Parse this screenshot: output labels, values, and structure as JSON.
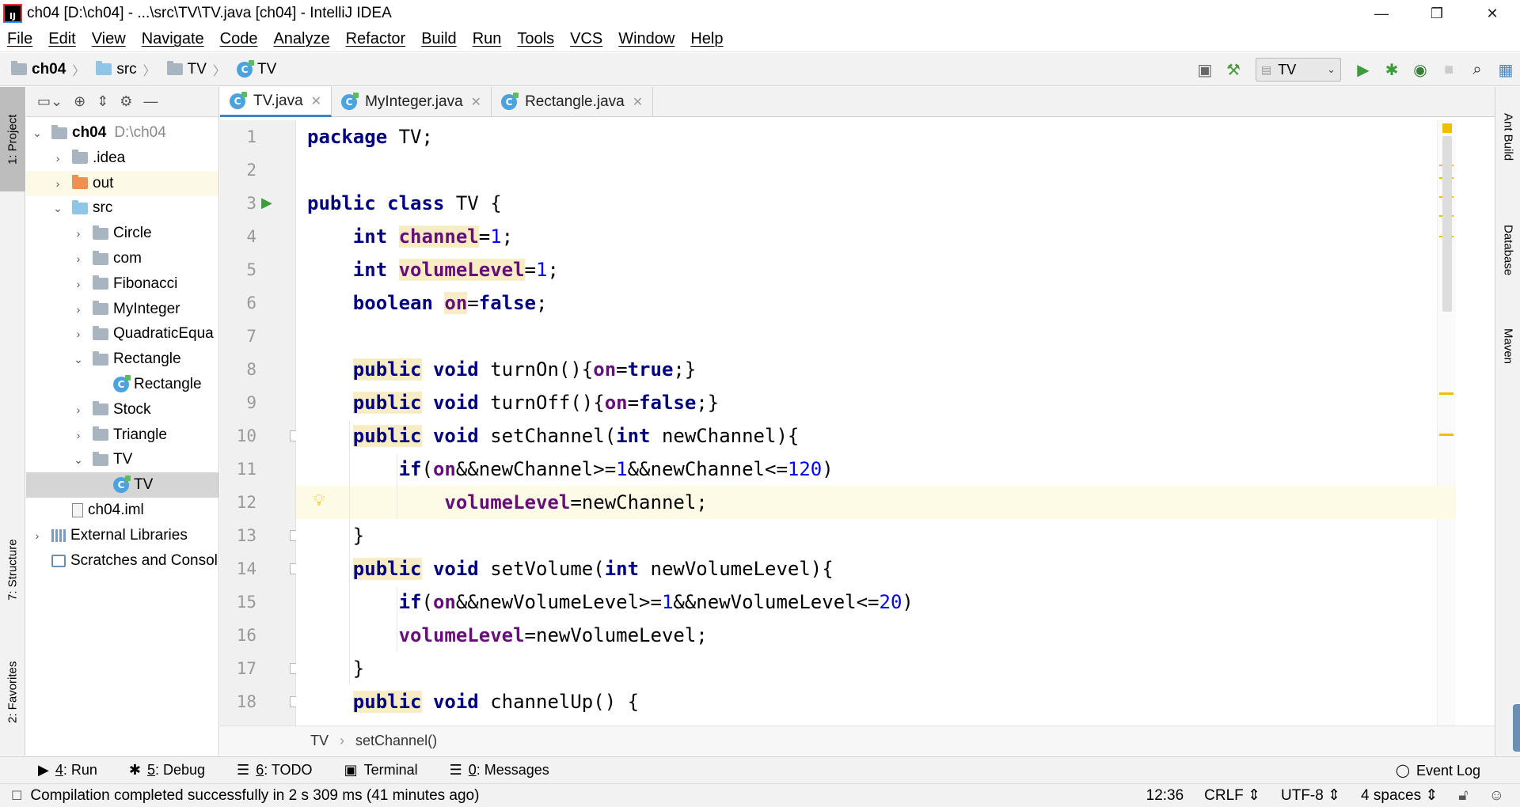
{
  "window": {
    "title": "ch04 [D:\\ch04] - ...\\src\\TV\\TV.java [ch04] - IntelliJ IDEA",
    "app_icon_text": "IJ",
    "controls": [
      "—",
      "❐",
      "✕"
    ]
  },
  "menu": [
    "File",
    "Edit",
    "View",
    "Navigate",
    "Code",
    "Analyze",
    "Refactor",
    "Build",
    "Run",
    "Tools",
    "VCS",
    "Window",
    "Help"
  ],
  "navbar": {
    "breadcrumbs": [
      "ch04",
      "src",
      "TV",
      "TV"
    ],
    "run_config": "TV"
  },
  "left_tool_tabs": [
    "1: Project",
    "7: Structure",
    "2: Favorites"
  ],
  "right_tool_tabs": [
    "Ant Build",
    "Database",
    "Maven"
  ],
  "project_tree": [
    {
      "label": "ch04",
      "path": "D:\\ch04",
      "depth": 0,
      "arrow": "⌄",
      "icon": "folder-grey",
      "bold": true
    },
    {
      "label": ".idea",
      "depth": 1,
      "arrow": "›",
      "icon": "folder-grey"
    },
    {
      "label": "out",
      "depth": 1,
      "arrow": "›",
      "icon": "folder-orange"
    },
    {
      "label": "src",
      "depth": 1,
      "arrow": "⌄",
      "icon": "folder-blue"
    },
    {
      "label": "Circle",
      "depth": 2,
      "arrow": "›",
      "icon": "folder-grey"
    },
    {
      "label": "com",
      "depth": 2,
      "arrow": "›",
      "icon": "folder-grey"
    },
    {
      "label": "Fibonacci",
      "depth": 2,
      "arrow": "›",
      "icon": "folder-grey"
    },
    {
      "label": "MyInteger",
      "depth": 2,
      "arrow": "›",
      "icon": "folder-grey"
    },
    {
      "label": "QuadraticEqua",
      "depth": 2,
      "arrow": "›",
      "icon": "folder-grey"
    },
    {
      "label": "Rectangle",
      "depth": 2,
      "arrow": "⌄",
      "icon": "folder-grey"
    },
    {
      "label": "Rectangle",
      "depth": 3,
      "arrow": "",
      "icon": "class"
    },
    {
      "label": "Stock",
      "depth": 2,
      "arrow": "›",
      "icon": "folder-grey"
    },
    {
      "label": "Triangle",
      "depth": 2,
      "arrow": "›",
      "icon": "folder-grey"
    },
    {
      "label": "TV",
      "depth": 2,
      "arrow": "⌄",
      "icon": "folder-grey"
    },
    {
      "label": "TV",
      "depth": 3,
      "arrow": "",
      "icon": "class",
      "selected": true
    },
    {
      "label": "ch04.iml",
      "depth": 1,
      "arrow": "",
      "icon": "file"
    },
    {
      "label": "External Libraries",
      "depth": 0,
      "arrow": "›",
      "icon": "library"
    },
    {
      "label": "Scratches and Consol",
      "depth": 0,
      "arrow": "",
      "icon": "scratch"
    }
  ],
  "editor_tabs": [
    {
      "label": "TV.java",
      "active": true
    },
    {
      "label": "MyInteger.java",
      "active": false
    },
    {
      "label": "Rectangle.java",
      "active": false
    }
  ],
  "code_lines": [
    [
      [
        "kw",
        "package"
      ],
      [
        "t",
        " TV;"
      ]
    ],
    [],
    [
      [
        "kw",
        "public class"
      ],
      [
        "t",
        " TV {"
      ]
    ],
    [
      [
        "t",
        "    "
      ],
      [
        "kw",
        "int "
      ],
      [
        "fldm",
        "channel"
      ],
      [
        "t",
        "="
      ],
      [
        "num",
        "1"
      ],
      [
        "t",
        ";"
      ]
    ],
    [
      [
        "t",
        "    "
      ],
      [
        "kw",
        "int "
      ],
      [
        "fldm",
        "volumeLevel"
      ],
      [
        "t",
        "="
      ],
      [
        "num",
        "1"
      ],
      [
        "t",
        ";"
      ]
    ],
    [
      [
        "t",
        "    "
      ],
      [
        "kw",
        "boolean "
      ],
      [
        "fldm",
        "on"
      ],
      [
        "t",
        "="
      ],
      [
        "kw",
        "false"
      ],
      [
        "t",
        ";"
      ]
    ],
    [],
    [
      [
        "t",
        "    "
      ],
      [
        "kwm",
        "public"
      ],
      [
        "kw",
        " void"
      ],
      [
        "t",
        " turnOn(){"
      ],
      [
        "fld",
        "on"
      ],
      [
        "t",
        "="
      ],
      [
        "kw",
        "true"
      ],
      [
        "t",
        ";}"
      ]
    ],
    [
      [
        "t",
        "    "
      ],
      [
        "kwm",
        "public"
      ],
      [
        "kw",
        " void"
      ],
      [
        "t",
        " turnOff(){"
      ],
      [
        "fld",
        "on"
      ],
      [
        "t",
        "="
      ],
      [
        "kw",
        "false"
      ],
      [
        "t",
        ";}"
      ]
    ],
    [
      [
        "t",
        "    "
      ],
      [
        "kwm",
        "public"
      ],
      [
        "kw",
        " void"
      ],
      [
        "t",
        " setChannel("
      ],
      [
        "kw",
        "int"
      ],
      [
        "t",
        " newChannel){"
      ]
    ],
    [
      [
        "t",
        "        "
      ],
      [
        "kw",
        "if"
      ],
      [
        "t",
        "("
      ],
      [
        "fld",
        "on"
      ],
      [
        "t",
        "&&newChannel>="
      ],
      [
        "num",
        "1"
      ],
      [
        "t",
        "&&newChannel<="
      ],
      [
        "num",
        "120"
      ],
      [
        "t",
        ")"
      ]
    ],
    [
      [
        "t",
        "            "
      ],
      [
        "fld",
        "volumeLevel"
      ],
      [
        "t",
        "=newChannel;"
      ]
    ],
    [
      [
        "t",
        "    }"
      ]
    ],
    [
      [
        "t",
        "    "
      ],
      [
        "kwm",
        "public"
      ],
      [
        "kw",
        " void"
      ],
      [
        "t",
        " setVolume("
      ],
      [
        "kw",
        "int"
      ],
      [
        "t",
        " newVolumeLevel){"
      ]
    ],
    [
      [
        "t",
        "        "
      ],
      [
        "kw",
        "if"
      ],
      [
        "t",
        "("
      ],
      [
        "fld",
        "on"
      ],
      [
        "t",
        "&&newVolumeLevel>="
      ],
      [
        "num",
        "1"
      ],
      [
        "t",
        "&&newVolumeLevel<="
      ],
      [
        "num",
        "20"
      ],
      [
        "t",
        ")"
      ]
    ],
    [
      [
        "t",
        "        "
      ],
      [
        "fld",
        "volumeLevel"
      ],
      [
        "t",
        "=newVolumeLevel;"
      ]
    ],
    [
      [
        "t",
        "    }"
      ]
    ],
    [
      [
        "t",
        "    "
      ],
      [
        "kwm",
        "public"
      ],
      [
        "kw",
        " void"
      ],
      [
        "t",
        " channelUp() {"
      ]
    ]
  ],
  "current_line": 12,
  "editor_breadcrumb": [
    "TV",
    "setChannel()"
  ],
  "bottom_tabs": [
    {
      "key": "4",
      "label": ": Run",
      "icon": "▶"
    },
    {
      "key": "5",
      "label": ": Debug",
      "icon": "✱"
    },
    {
      "key": "6",
      "label": ": TODO",
      "icon": "☰"
    },
    {
      "key": "",
      "label": "Terminal",
      "icon": "▣"
    },
    {
      "key": "0",
      "label": ": Messages",
      "icon": "☰"
    }
  ],
  "event_log": "Event Log",
  "status": {
    "message": "Compilation completed successfully in 2 s 309 ms (41 minutes ago)",
    "position": "12:36",
    "line_sep": "CRLF",
    "encoding": "UTF-8",
    "indent": "4 spaces"
  },
  "colors": {
    "keyword": "#000080",
    "field": "#660e7a",
    "number": "#0000ff",
    "accent": "#4083c9"
  }
}
